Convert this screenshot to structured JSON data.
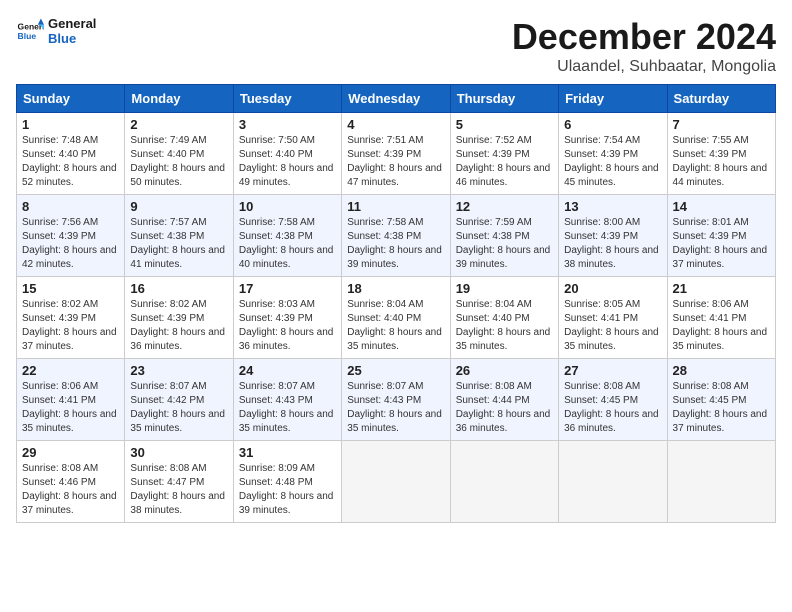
{
  "header": {
    "logo_general": "General",
    "logo_blue": "Blue",
    "month_title": "December 2024",
    "location": "Ulaandel, Suhbaatar, Mongolia"
  },
  "weekdays": [
    "Sunday",
    "Monday",
    "Tuesday",
    "Wednesday",
    "Thursday",
    "Friday",
    "Saturday"
  ],
  "weeks": [
    [
      {
        "day": "1",
        "sunrise": "Sunrise: 7:48 AM",
        "sunset": "Sunset: 4:40 PM",
        "daylight": "Daylight: 8 hours and 52 minutes."
      },
      {
        "day": "2",
        "sunrise": "Sunrise: 7:49 AM",
        "sunset": "Sunset: 4:40 PM",
        "daylight": "Daylight: 8 hours and 50 minutes."
      },
      {
        "day": "3",
        "sunrise": "Sunrise: 7:50 AM",
        "sunset": "Sunset: 4:40 PM",
        "daylight": "Daylight: 8 hours and 49 minutes."
      },
      {
        "day": "4",
        "sunrise": "Sunrise: 7:51 AM",
        "sunset": "Sunset: 4:39 PM",
        "daylight": "Daylight: 8 hours and 47 minutes."
      },
      {
        "day": "5",
        "sunrise": "Sunrise: 7:52 AM",
        "sunset": "Sunset: 4:39 PM",
        "daylight": "Daylight: 8 hours and 46 minutes."
      },
      {
        "day": "6",
        "sunrise": "Sunrise: 7:54 AM",
        "sunset": "Sunset: 4:39 PM",
        "daylight": "Daylight: 8 hours and 45 minutes."
      },
      {
        "day": "7",
        "sunrise": "Sunrise: 7:55 AM",
        "sunset": "Sunset: 4:39 PM",
        "daylight": "Daylight: 8 hours and 44 minutes."
      }
    ],
    [
      {
        "day": "8",
        "sunrise": "Sunrise: 7:56 AM",
        "sunset": "Sunset: 4:39 PM",
        "daylight": "Daylight: 8 hours and 42 minutes."
      },
      {
        "day": "9",
        "sunrise": "Sunrise: 7:57 AM",
        "sunset": "Sunset: 4:38 PM",
        "daylight": "Daylight: 8 hours and 41 minutes."
      },
      {
        "day": "10",
        "sunrise": "Sunrise: 7:58 AM",
        "sunset": "Sunset: 4:38 PM",
        "daylight": "Daylight: 8 hours and 40 minutes."
      },
      {
        "day": "11",
        "sunrise": "Sunrise: 7:58 AM",
        "sunset": "Sunset: 4:38 PM",
        "daylight": "Daylight: 8 hours and 39 minutes."
      },
      {
        "day": "12",
        "sunrise": "Sunrise: 7:59 AM",
        "sunset": "Sunset: 4:38 PM",
        "daylight": "Daylight: 8 hours and 39 minutes."
      },
      {
        "day": "13",
        "sunrise": "Sunrise: 8:00 AM",
        "sunset": "Sunset: 4:39 PM",
        "daylight": "Daylight: 8 hours and 38 minutes."
      },
      {
        "day": "14",
        "sunrise": "Sunrise: 8:01 AM",
        "sunset": "Sunset: 4:39 PM",
        "daylight": "Daylight: 8 hours and 37 minutes."
      }
    ],
    [
      {
        "day": "15",
        "sunrise": "Sunrise: 8:02 AM",
        "sunset": "Sunset: 4:39 PM",
        "daylight": "Daylight: 8 hours and 37 minutes."
      },
      {
        "day": "16",
        "sunrise": "Sunrise: 8:02 AM",
        "sunset": "Sunset: 4:39 PM",
        "daylight": "Daylight: 8 hours and 36 minutes."
      },
      {
        "day": "17",
        "sunrise": "Sunrise: 8:03 AM",
        "sunset": "Sunset: 4:39 PM",
        "daylight": "Daylight: 8 hours and 36 minutes."
      },
      {
        "day": "18",
        "sunrise": "Sunrise: 8:04 AM",
        "sunset": "Sunset: 4:40 PM",
        "daylight": "Daylight: 8 hours and 35 minutes."
      },
      {
        "day": "19",
        "sunrise": "Sunrise: 8:04 AM",
        "sunset": "Sunset: 4:40 PM",
        "daylight": "Daylight: 8 hours and 35 minutes."
      },
      {
        "day": "20",
        "sunrise": "Sunrise: 8:05 AM",
        "sunset": "Sunset: 4:41 PM",
        "daylight": "Daylight: 8 hours and 35 minutes."
      },
      {
        "day": "21",
        "sunrise": "Sunrise: 8:06 AM",
        "sunset": "Sunset: 4:41 PM",
        "daylight": "Daylight: 8 hours and 35 minutes."
      }
    ],
    [
      {
        "day": "22",
        "sunrise": "Sunrise: 8:06 AM",
        "sunset": "Sunset: 4:41 PM",
        "daylight": "Daylight: 8 hours and 35 minutes."
      },
      {
        "day": "23",
        "sunrise": "Sunrise: 8:07 AM",
        "sunset": "Sunset: 4:42 PM",
        "daylight": "Daylight: 8 hours and 35 minutes."
      },
      {
        "day": "24",
        "sunrise": "Sunrise: 8:07 AM",
        "sunset": "Sunset: 4:43 PM",
        "daylight": "Daylight: 8 hours and 35 minutes."
      },
      {
        "day": "25",
        "sunrise": "Sunrise: 8:07 AM",
        "sunset": "Sunset: 4:43 PM",
        "daylight": "Daylight: 8 hours and 35 minutes."
      },
      {
        "day": "26",
        "sunrise": "Sunrise: 8:08 AM",
        "sunset": "Sunset: 4:44 PM",
        "daylight": "Daylight: 8 hours and 36 minutes."
      },
      {
        "day": "27",
        "sunrise": "Sunrise: 8:08 AM",
        "sunset": "Sunset: 4:45 PM",
        "daylight": "Daylight: 8 hours and 36 minutes."
      },
      {
        "day": "28",
        "sunrise": "Sunrise: 8:08 AM",
        "sunset": "Sunset: 4:45 PM",
        "daylight": "Daylight: 8 hours and 37 minutes."
      }
    ],
    [
      {
        "day": "29",
        "sunrise": "Sunrise: 8:08 AM",
        "sunset": "Sunset: 4:46 PM",
        "daylight": "Daylight: 8 hours and 37 minutes."
      },
      {
        "day": "30",
        "sunrise": "Sunrise: 8:08 AM",
        "sunset": "Sunset: 4:47 PM",
        "daylight": "Daylight: 8 hours and 38 minutes."
      },
      {
        "day": "31",
        "sunrise": "Sunrise: 8:09 AM",
        "sunset": "Sunset: 4:48 PM",
        "daylight": "Daylight: 8 hours and 39 minutes."
      },
      null,
      null,
      null,
      null
    ]
  ]
}
